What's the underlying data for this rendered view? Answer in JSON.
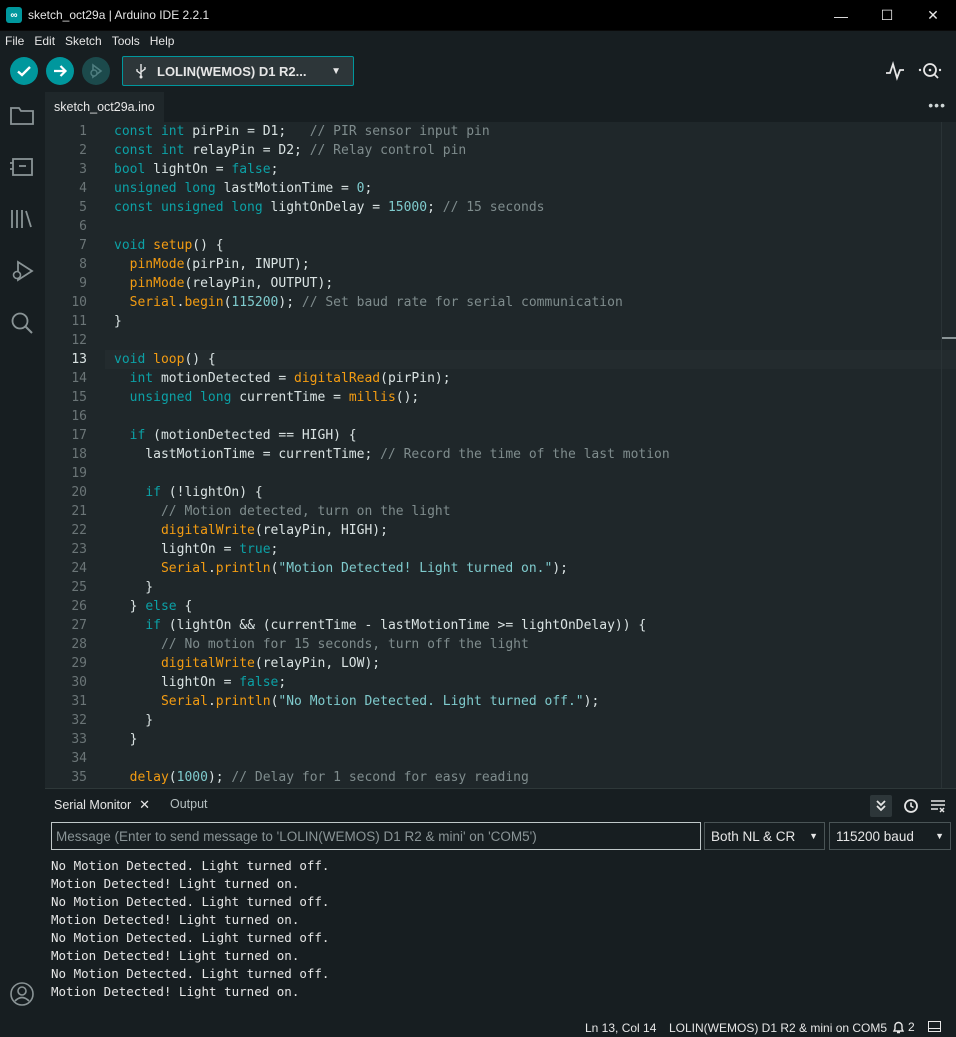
{
  "window": {
    "title": "sketch_oct29a | Arduino IDE 2.2.1",
    "app_icon": "arduino-infinity-icon",
    "app_icon_glyph": "∞",
    "minimize_glyph": "—",
    "maximize_glyph": "☐",
    "close_glyph": "✕"
  },
  "menu": [
    "File",
    "Edit",
    "Sketch",
    "Tools",
    "Help"
  ],
  "toolbar": {
    "board_name": "LOLIN(WEMOS) D1 R2...",
    "board_chevron": "▼",
    "accent_color": "#00979d"
  },
  "editor": {
    "tab_label": "sketch_oct29a.ino",
    "more_glyph": "•••",
    "active_line": 13,
    "line_numbers": [
      "1",
      "2",
      "3",
      "4",
      "5",
      "6",
      "7",
      "8",
      "9",
      "10",
      "11",
      "12",
      "13",
      "14",
      "15",
      "16",
      "17",
      "18",
      "19",
      "20",
      "21",
      "22",
      "23",
      "24",
      "25",
      "26",
      "27",
      "28",
      "29",
      "30",
      "31",
      "32",
      "33",
      "34",
      "35"
    ],
    "lines": [
      [
        [
          "kw",
          "const int "
        ],
        [
          "",
          "pirPin = D1;   "
        ],
        [
          "cm",
          "// PIR sensor input pin"
        ]
      ],
      [
        [
          "kw",
          "const int "
        ],
        [
          "",
          "relayPin = D2; "
        ],
        [
          "cm",
          "// Relay control pin"
        ]
      ],
      [
        [
          "kw",
          "bool "
        ],
        [
          "",
          "lightOn = "
        ],
        [
          "kw",
          "false"
        ],
        [
          "",
          ";"
        ]
      ],
      [
        [
          "kw",
          "unsigned long "
        ],
        [
          "",
          "lastMotionTime = "
        ],
        [
          "num",
          "0"
        ],
        [
          "",
          ";"
        ]
      ],
      [
        [
          "kw",
          "const unsigned long "
        ],
        [
          "",
          "lightOnDelay = "
        ],
        [
          "num",
          "15000"
        ],
        [
          "",
          "; "
        ],
        [
          "cm",
          "// 15 seconds"
        ]
      ],
      [],
      [
        [
          "kw",
          "void "
        ],
        [
          "fn",
          "setup"
        ],
        [
          "",
          "() {"
        ]
      ],
      [
        [
          "",
          "  "
        ],
        [
          "fn",
          "pinMode"
        ],
        [
          "",
          "(pirPin, INPUT);"
        ]
      ],
      [
        [
          "",
          "  "
        ],
        [
          "fn",
          "pinMode"
        ],
        [
          "",
          "(relayPin, OUTPUT);"
        ]
      ],
      [
        [
          "",
          "  "
        ],
        [
          "ser",
          "Serial"
        ],
        [
          "",
          "."
        ],
        [
          "fn",
          "begin"
        ],
        [
          "",
          "("
        ],
        [
          "num",
          "115200"
        ],
        [
          "",
          "); "
        ],
        [
          "cm",
          "// Set baud rate for serial communication"
        ]
      ],
      [
        [
          "",
          "}"
        ]
      ],
      [],
      [
        [
          "kw",
          "void "
        ],
        [
          "fn",
          "loop"
        ],
        [
          "",
          "() {"
        ]
      ],
      [
        [
          "",
          "  "
        ],
        [
          "kw",
          "int "
        ],
        [
          "",
          "motionDetected = "
        ],
        [
          "fn",
          "digitalRead"
        ],
        [
          "",
          "(pirPin);"
        ]
      ],
      [
        [
          "",
          "  "
        ],
        [
          "kw",
          "unsigned long "
        ],
        [
          "",
          "currentTime = "
        ],
        [
          "fn",
          "millis"
        ],
        [
          "",
          "();"
        ]
      ],
      [],
      [
        [
          "",
          "  "
        ],
        [
          "kw",
          "if "
        ],
        [
          "",
          "(motionDetected == HIGH) {"
        ]
      ],
      [
        [
          "",
          "    lastMotionTime = currentTime; "
        ],
        [
          "cm",
          "// Record the time of the last motion"
        ]
      ],
      [],
      [
        [
          "",
          "    "
        ],
        [
          "kw",
          "if "
        ],
        [
          "",
          "(!lightOn) {"
        ]
      ],
      [
        [
          "",
          "      "
        ],
        [
          "cm",
          "// Motion detected, turn on the light"
        ]
      ],
      [
        [
          "",
          "      "
        ],
        [
          "fn",
          "digitalWrite"
        ],
        [
          "",
          "(relayPin, HIGH);"
        ]
      ],
      [
        [
          "",
          "      lightOn = "
        ],
        [
          "kw",
          "true"
        ],
        [
          "",
          ";"
        ]
      ],
      [
        [
          "",
          "      "
        ],
        [
          "ser",
          "Serial"
        ],
        [
          "",
          "."
        ],
        [
          "fn",
          "println"
        ],
        [
          "",
          "("
        ],
        [
          "str",
          "\"Motion Detected! Light turned on.\""
        ],
        [
          "",
          ");"
        ]
      ],
      [
        [
          "",
          "    }"
        ]
      ],
      [
        [
          "",
          "  } "
        ],
        [
          "kw",
          "else "
        ],
        [
          "",
          "{"
        ]
      ],
      [
        [
          "",
          "    "
        ],
        [
          "kw",
          "if "
        ],
        [
          "",
          "(lightOn && (currentTime - lastMotionTime >= lightOnDelay)) {"
        ]
      ],
      [
        [
          "",
          "      "
        ],
        [
          "cm",
          "// No motion for 15 seconds, turn off the light"
        ]
      ],
      [
        [
          "",
          "      "
        ],
        [
          "fn",
          "digitalWrite"
        ],
        [
          "",
          "(relayPin, LOW);"
        ]
      ],
      [
        [
          "",
          "      lightOn = "
        ],
        [
          "kw",
          "false"
        ],
        [
          "",
          ";"
        ]
      ],
      [
        [
          "",
          "      "
        ],
        [
          "ser",
          "Serial"
        ],
        [
          "",
          "."
        ],
        [
          "fn",
          "println"
        ],
        [
          "",
          "("
        ],
        [
          "str",
          "\"No Motion Detected. Light turned off.\""
        ],
        [
          "",
          ");"
        ]
      ],
      [
        [
          "",
          "    }"
        ]
      ],
      [
        [
          "",
          "  }"
        ]
      ],
      [],
      [
        [
          "",
          "  "
        ],
        [
          "fn",
          "delay"
        ],
        [
          "",
          "("
        ],
        [
          "num",
          "1000"
        ],
        [
          "",
          "); "
        ],
        [
          "cm",
          "// Delay for 1 second for easy reading"
        ]
      ]
    ]
  },
  "panel": {
    "serial_tab_label": "Serial Monitor",
    "serial_tab_close": "✕",
    "output_tab_label": "Output",
    "message_placeholder": "Message (Enter to send message to 'LOLIN(WEMOS) D1 R2 & mini' on 'COM5')",
    "line_ending": "Both NL & CR",
    "baud_rate": "115200 baud",
    "caret": "▼",
    "serial_lines": [
      "No Motion Detected. Light turned off.",
      "Motion Detected! Light turned on.",
      "No Motion Detected. Light turned off.",
      "Motion Detected! Light turned on.",
      "No Motion Detected. Light turned off.",
      "Motion Detected! Light turned on.",
      "No Motion Detected. Light turned off.",
      "Motion Detected! Light turned on."
    ]
  },
  "status": {
    "cursor_position": "Ln 13, Col 14",
    "board_port": "LOLIN(WEMOS) D1 R2 & mini on COM5",
    "notification_count": "2"
  }
}
